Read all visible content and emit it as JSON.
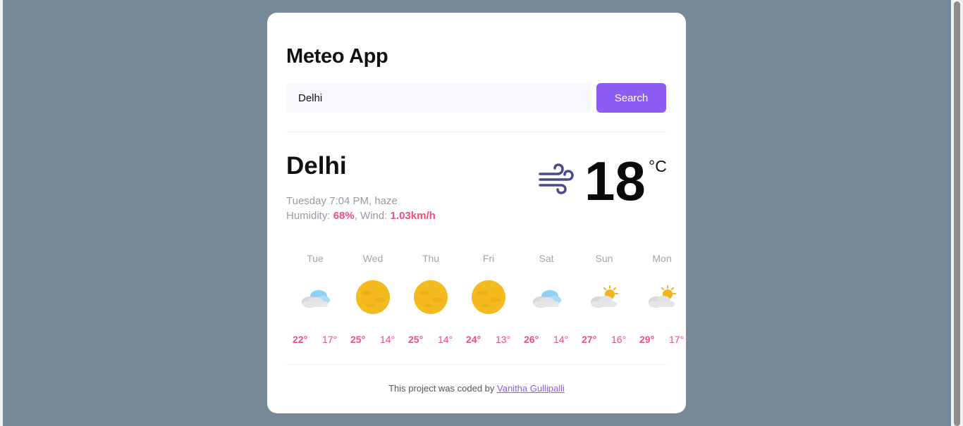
{
  "app": {
    "title": "Meteo App"
  },
  "search": {
    "value": "Delhi",
    "button_label": "Search"
  },
  "current": {
    "city": "Delhi",
    "description": "Tuesday 7:04 PM, haze",
    "humidity_label": "Humidity: ",
    "humidity_value": "68%",
    "wind_label": ", Wind: ",
    "wind_value": "1.03km/h",
    "temperature": "18",
    "unit": "°C",
    "icon": "wind-icon"
  },
  "forecast": [
    {
      "day": "Tue",
      "max": "22°",
      "min": "17°",
      "icon": "cloudy-icon"
    },
    {
      "day": "Wed",
      "max": "25°",
      "min": "14°",
      "icon": "sun-haze-icon"
    },
    {
      "day": "Thu",
      "max": "25°",
      "min": "14°",
      "icon": "sun-haze-icon"
    },
    {
      "day": "Fri",
      "max": "24°",
      "min": "13°",
      "icon": "sun-haze-icon"
    },
    {
      "day": "Sat",
      "max": "26°",
      "min": "14°",
      "icon": "cloudy-icon"
    },
    {
      "day": "Sun",
      "max": "27°",
      "min": "16°",
      "icon": "partly-cloudy-icon"
    },
    {
      "day": "Mon",
      "max": "29°",
      "min": "17°",
      "icon": "partly-cloudy-icon"
    }
  ],
  "footer": {
    "text": "This project was coded by ",
    "link_text": "Vanitha Gullipalli"
  },
  "colors": {
    "background": "#778899",
    "accent": "#8c5cf3",
    "highlight": "#ef4f7a"
  }
}
